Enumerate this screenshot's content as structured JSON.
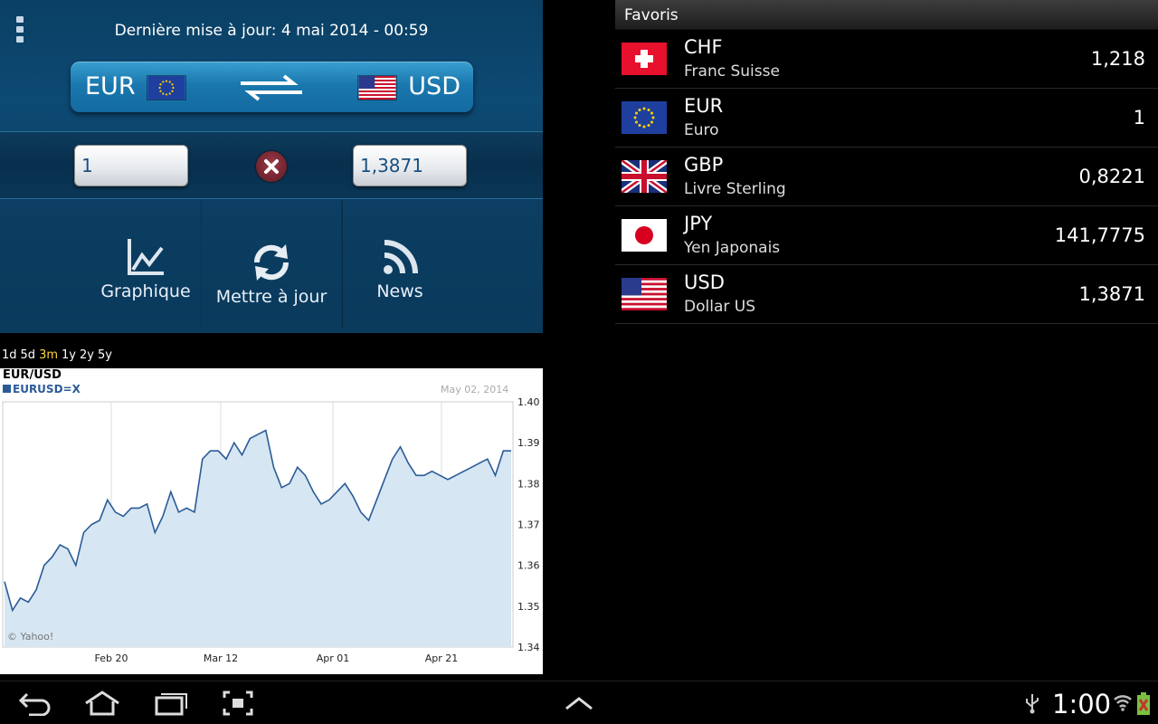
{
  "header": {
    "update_text": "Dernière mise à jour: 4 mai 2014 - 00:59",
    "menu_icon": "overflow-menu-icon"
  },
  "converter": {
    "from_code": "EUR",
    "to_code": "USD",
    "from_amount": "1",
    "to_amount": "1,3871",
    "swap_icon": "swap-arrows-icon",
    "clear_icon": "clear-icon"
  },
  "actions": {
    "chart_label": "Graphique",
    "refresh_label": "Mettre à jour",
    "news_label": "News"
  },
  "ranges": {
    "items": [
      "1d",
      "5d",
      "3m",
      "1y",
      "2y",
      "5y"
    ],
    "active": "3m"
  },
  "chart_data": {
    "type": "area",
    "title": "EUR/USD",
    "series_name": "EURUSD=X",
    "date_label": "May 02, 2014",
    "credit": "© Yahoo!",
    "x_ticks": [
      "Feb 20",
      "Mar 12",
      "Apr 01",
      "Apr 21"
    ],
    "y_ticks": [
      "1.40",
      "1.39",
      "1.38",
      "1.37",
      "1.36",
      "1.35",
      "1.34"
    ],
    "ylim": [
      1.34,
      1.4
    ],
    "grid": true,
    "series": [
      {
        "name": "EURUSD=X",
        "values": [
          1.356,
          1.349,
          1.352,
          1.351,
          1.354,
          1.36,
          1.362,
          1.365,
          1.364,
          1.36,
          1.368,
          1.37,
          1.371,
          1.376,
          1.373,
          1.372,
          1.374,
          1.374,
          1.375,
          1.368,
          1.372,
          1.378,
          1.373,
          1.374,
          1.373,
          1.386,
          1.388,
          1.388,
          1.386,
          1.39,
          1.387,
          1.391,
          1.392,
          1.393,
          1.384,
          1.379,
          1.38,
          1.384,
          1.382,
          1.378,
          1.375,
          1.376,
          1.378,
          1.38,
          1.377,
          1.373,
          1.371,
          1.376,
          1.381,
          1.386,
          1.389,
          1.385,
          1.382,
          1.382,
          1.383,
          1.382,
          1.381,
          1.382,
          1.383,
          1.384,
          1.385,
          1.386,
          1.382,
          1.388,
          1.388
        ]
      }
    ]
  },
  "favorites": {
    "title": "Favoris",
    "items": [
      {
        "code": "CHF",
        "name": "Franc Suisse",
        "rate": "1,218",
        "flag": "flag-switzerland-icon"
      },
      {
        "code": "EUR",
        "name": "Euro",
        "rate": "1",
        "flag": "flag-eu-icon"
      },
      {
        "code": "GBP",
        "name": "Livre Sterling",
        "rate": "0,8221",
        "flag": "flag-uk-icon"
      },
      {
        "code": "JPY",
        "name": "Yen Japonais",
        "rate": "141,7775",
        "flag": "flag-japan-icon"
      },
      {
        "code": "USD",
        "name": "Dollar US",
        "rate": "1,3871",
        "flag": "flag-usa-icon"
      }
    ]
  },
  "system_bar": {
    "clock": "1:00",
    "icons": [
      "back-icon",
      "home-icon",
      "recent-apps-icon",
      "screenshot-icon",
      "chevron-up-icon",
      "usb-icon",
      "wifi-icon",
      "battery-icon"
    ]
  },
  "colors": {
    "panel_blue": "#0d4a74",
    "accent_yellow": "#ffd43a",
    "chart_line": "#2b5b97",
    "chart_fill": "#d6e6f2"
  }
}
